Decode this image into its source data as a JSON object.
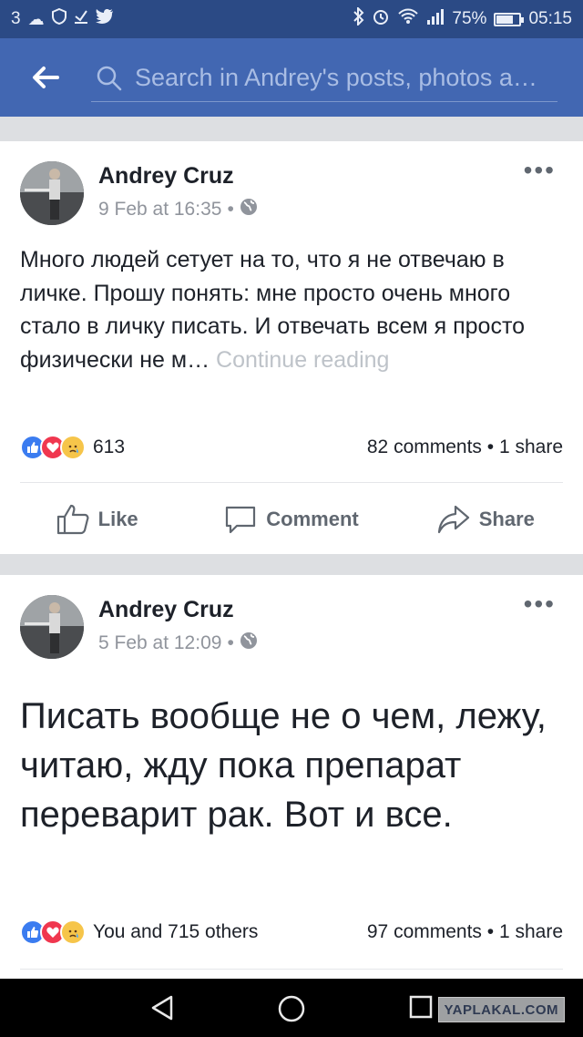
{
  "status_bar": {
    "carrier_signal": "3",
    "battery_percent": "75%",
    "battery_level": 0.75,
    "time": "05:15",
    "icons": [
      "messenger-icon",
      "shield-icon",
      "download-icon",
      "twitter-icon",
      "bluetooth-icon",
      "alarm-icon",
      "wifi-icon",
      "signal-icon",
      "battery-icon"
    ]
  },
  "header": {
    "search_placeholder": "Search in Andrey's posts, photos a…",
    "colors": {
      "header": "#4267b2",
      "status": "#2b4a85"
    }
  },
  "posts": [
    {
      "author": "Andrey Cruz",
      "date": "9 Feb at 16:35",
      "text": "Много людей сетует на то, что я не отвечаю в личке. Прошу понять: мне просто очень много стало в личку писать. И отвечать всем я просто физически не м… ",
      "continue_label": "Continue reading",
      "reaction_count": "613",
      "comments_shares": "82 comments • 1 share"
    },
    {
      "author": "Andrey Cruz",
      "date": "5 Feb at 12:09",
      "text": "Писать вообще не о чем, лежу, читаю, жду пока препарат переварит рак. Вот и все.",
      "reaction_count": "You and 715 others",
      "comments_shares": "97 comments • 1 share"
    }
  ],
  "actions": {
    "like": "Like",
    "comment": "Comment",
    "share": "Share"
  },
  "watermark": "YAPLAKAL.COM"
}
